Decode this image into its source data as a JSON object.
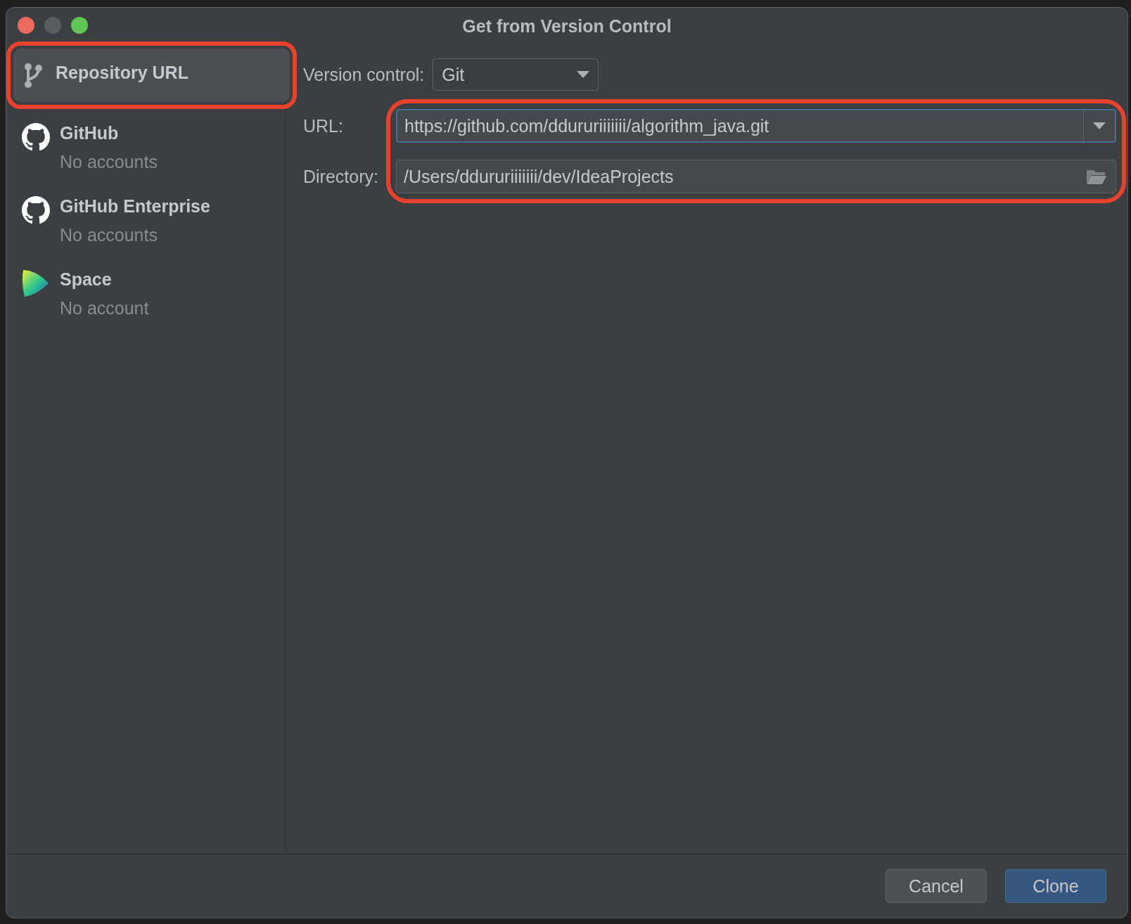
{
  "window": {
    "title": "Get from Version Control"
  },
  "sidebar": {
    "items": [
      {
        "kind": "branch",
        "title": "Repository URL",
        "selected": true,
        "annotated": true
      },
      {
        "kind": "github",
        "title": "GitHub",
        "subtitle": "No accounts",
        "selected": false,
        "annotated": false
      },
      {
        "kind": "github",
        "title": "GitHub Enterprise",
        "subtitle": "No accounts",
        "selected": false,
        "annotated": false
      },
      {
        "kind": "space",
        "title": "Space",
        "subtitle": "No account",
        "selected": false,
        "annotated": false
      }
    ]
  },
  "form": {
    "version_control": {
      "label": "Version control:",
      "value": "Git"
    },
    "path_fields_annotated": true,
    "url": {
      "label": "URL:",
      "value": "https://github.com/ddururiiiiiii/algorithm_java.git",
      "focused": true
    },
    "directory": {
      "label": "Directory:",
      "value": "/Users/ddururiiiiiii/dev/IdeaProjects",
      "focused": false
    }
  },
  "buttons": [
    {
      "label": "Cancel",
      "kind": "secondary"
    },
    {
      "label": "Clone",
      "kind": "primary"
    }
  ]
}
